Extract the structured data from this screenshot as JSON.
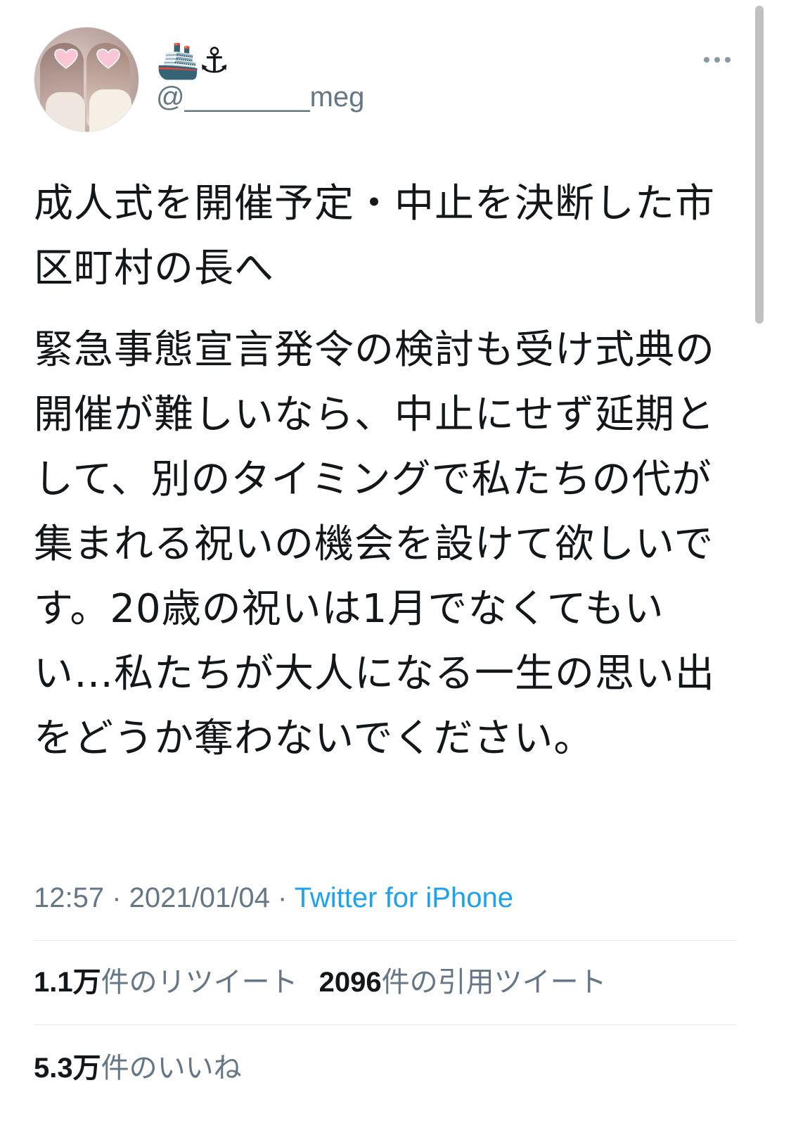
{
  "user": {
    "display_name": "🚢⚓",
    "handle": "@________meg"
  },
  "tweet": {
    "paragraph1": "成人式を開催予定・中止を決断した市区町村の長へ",
    "paragraph2": "緊急事態宣言発令の検討も受け式典の開催が難しいなら、中止にせず延期として、別のタイミングで私たちの代が集まれる祝いの機会を設けて欲しいです。20歳の祝いは1月でなくてもいい…私たちが大人になる一生の思い出をどうか奪わないでください。",
    "time": "12:57",
    "date": "2021/01/04",
    "separator": " · ",
    "source": "Twitter for iPhone"
  },
  "stats": {
    "retweets_count": "1.1万",
    "retweets_label": "件のリツイート",
    "quotes_count": "2096",
    "quotes_label": "件の引用ツイート",
    "likes_count": "5.3万",
    "likes_label": "件のいいね"
  },
  "icons": {
    "more": "more-horizontal-icon"
  },
  "colors": {
    "text": "#14171a",
    "secondary": "#657786",
    "link": "#1da1f2",
    "divider": "#e1e8ed"
  }
}
